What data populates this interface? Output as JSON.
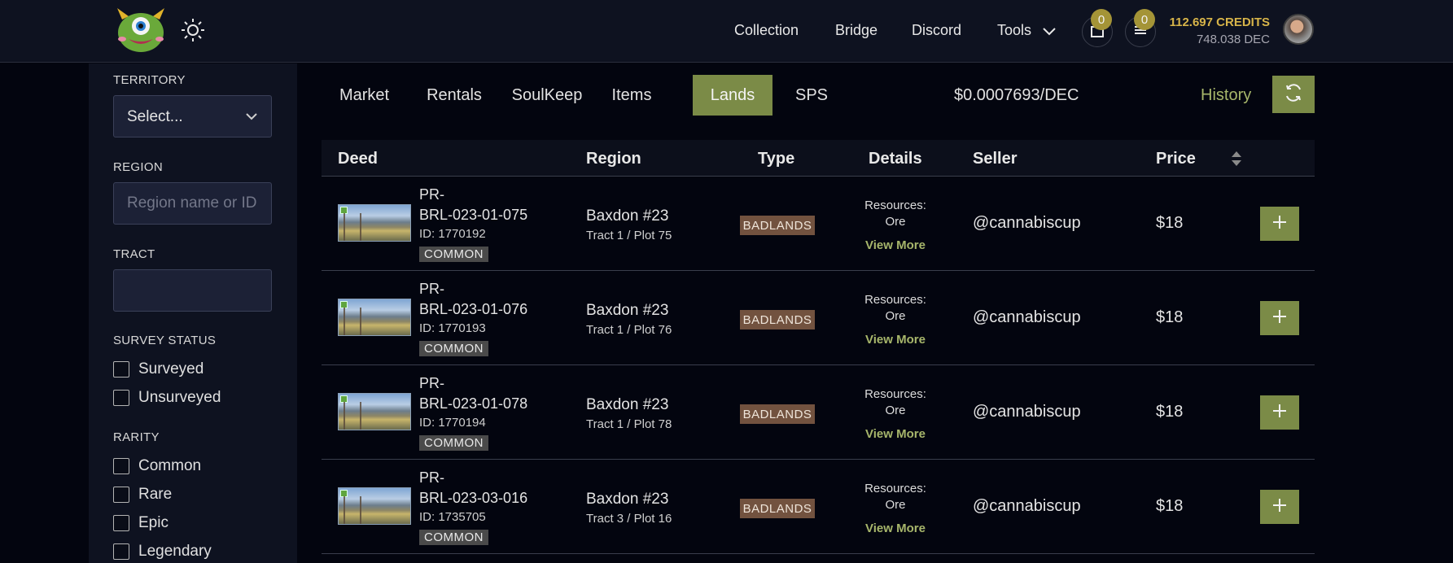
{
  "header": {
    "nav": [
      "Collection",
      "Bridge",
      "Discord",
      "Tools"
    ],
    "cart_count": "0",
    "list_count": "0",
    "credits": "112.697 CREDITS",
    "dec": "748.038 DEC",
    "colors": {
      "accent": "#7b8b47",
      "badge": "#a49437",
      "credits": "#d7b449"
    }
  },
  "sidebar": {
    "territory_label": "TERRITORY",
    "territory_value": "Select...",
    "region_label": "REGION",
    "region_placeholder": "Region name or ID",
    "tract_label": "TRACT",
    "tract_value": "",
    "survey_label": "SURVEY STATUS",
    "survey_options": [
      "Surveyed",
      "Unsurveyed"
    ],
    "rarity_label": "RARITY",
    "rarity_options": [
      "Common",
      "Rare",
      "Epic",
      "Legendary"
    ]
  },
  "tabs": [
    "Market",
    "Rentals",
    "SoulKeep",
    "Items",
    "Lands",
    "SPS"
  ],
  "active_tab": "Lands",
  "price_rate": "$0.0007693/DEC",
  "history_label": "History",
  "table": {
    "headers": [
      "Deed",
      "Region",
      "Type",
      "Details",
      "Seller",
      "Price"
    ],
    "rows": [
      {
        "deed_line1": "PR-",
        "deed_line2": "BRL-023-01-075",
        "id": "ID: 1770192",
        "rarity": "COMMON",
        "region": "Baxdon #23",
        "plot": "Tract 1 / Plot 75",
        "type": "BADLANDS",
        "details_label": "Resources:",
        "details_value": "Ore",
        "view_more": "View More",
        "seller": "@cannabiscup",
        "price": "$18"
      },
      {
        "deed_line1": "PR-",
        "deed_line2": "BRL-023-01-076",
        "id": "ID: 1770193",
        "rarity": "COMMON",
        "region": "Baxdon #23",
        "plot": "Tract 1 / Plot 76",
        "type": "BADLANDS",
        "details_label": "Resources:",
        "details_value": "Ore",
        "view_more": "View More",
        "seller": "@cannabiscup",
        "price": "$18"
      },
      {
        "deed_line1": "PR-",
        "deed_line2": "BRL-023-01-078",
        "id": "ID: 1770194",
        "rarity": "COMMON",
        "region": "Baxdon #23",
        "plot": "Tract 1 / Plot 78",
        "type": "BADLANDS",
        "details_label": "Resources:",
        "details_value": "Ore",
        "view_more": "View More",
        "seller": "@cannabiscup",
        "price": "$18"
      },
      {
        "deed_line1": "PR-",
        "deed_line2": "BRL-023-03-016",
        "id": "ID: 1735705",
        "rarity": "COMMON",
        "region": "Baxdon #23",
        "plot": "Tract 3 / Plot 16",
        "type": "BADLANDS",
        "details_label": "Resources:",
        "details_value": "Ore",
        "view_more": "View More",
        "seller": "@cannabiscup",
        "price": "$18"
      }
    ]
  }
}
